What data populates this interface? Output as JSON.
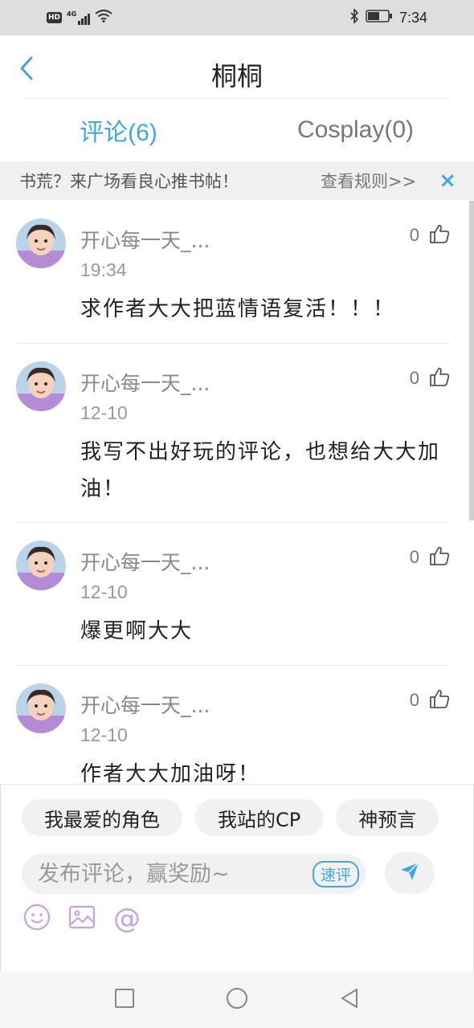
{
  "status_bar": {
    "hd": "HD",
    "network": "4G",
    "time": "7:34"
  },
  "header": {
    "title": "桐桐"
  },
  "tabs": [
    {
      "label": "评论(6)",
      "active": true
    },
    {
      "label": "Cosplay(0)",
      "active": false
    }
  ],
  "notice": {
    "text": "书荒？来广场看良心推书帖！",
    "link": "查看规则>>",
    "close": "×"
  },
  "comments": [
    {
      "user": "开心每一天_...",
      "time": "19:34",
      "likes": "0",
      "text": "求作者大大把蓝情语复活！！！"
    },
    {
      "user": "开心每一天_...",
      "time": "12-10",
      "likes": "0",
      "text": "我写不出好玩的评论，也想给大大加油！"
    },
    {
      "user": "开心每一天_...",
      "time": "12-10",
      "likes": "0",
      "text": "爆更啊大大"
    },
    {
      "user": "开心每一天_...",
      "time": "12-10",
      "likes": "0",
      "text": "作者大大加油呀！"
    }
  ],
  "composer": {
    "chips": [
      "我最爱的角色",
      "我站的CP",
      "神预言"
    ],
    "placeholder": "发布评论，赢奖励~",
    "quick_label": "速评",
    "at_symbol": "@"
  },
  "icons": {
    "back": "back-arrow-icon",
    "like": "thumbs-up-icon",
    "send": "send-icon",
    "emoji": "emoji-icon",
    "image": "image-icon",
    "mention": "at-icon"
  },
  "colors": {
    "accent": "#3ea7e6",
    "tool_icon": "#c9a1df"
  }
}
